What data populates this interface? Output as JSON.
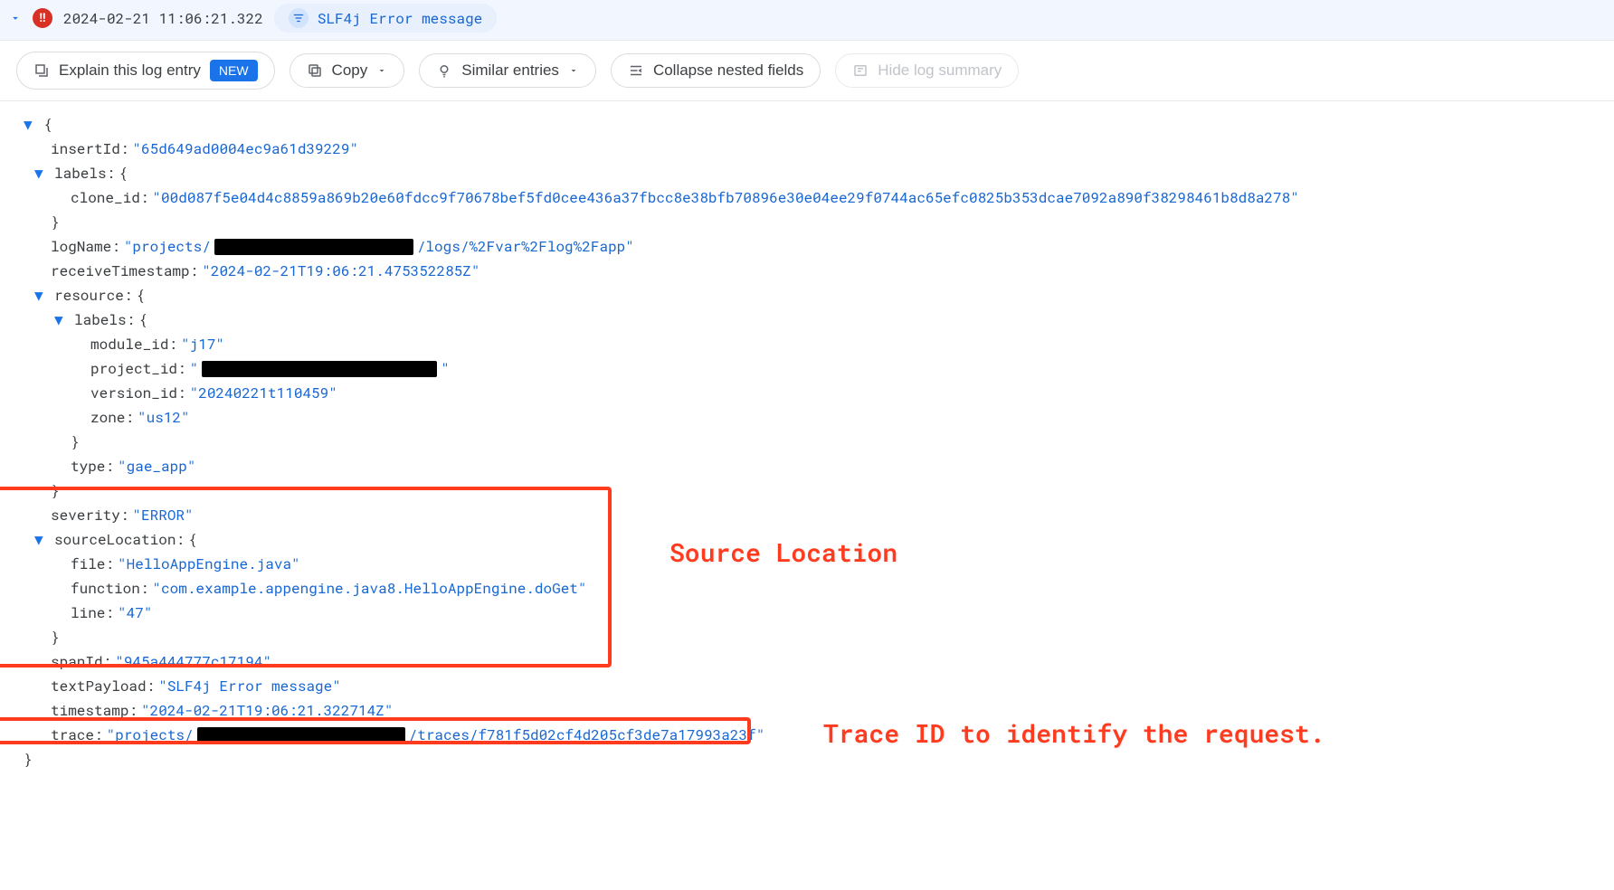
{
  "header": {
    "severity_symbol": "!!",
    "timestamp": "2024-02-21 11:06:21.322",
    "message": "SLF4j Error message"
  },
  "toolbar": {
    "explain": "Explain this log entry",
    "new_badge": "NEW",
    "copy": "Copy",
    "similar": "Similar entries",
    "collapse": "Collapse nested fields",
    "hide_summary": "Hide log summary"
  },
  "log": {
    "insertId_key": "insertId:",
    "insertId_val": "\"65d649ad0004ec9a61d39229\"",
    "labels_key": "labels:",
    "clone_id_key": "clone_id:",
    "clone_id_val": "\"00d087f5e04d4c8859a869b20e60fdcc9f70678bef5fd0cee436a37fbcc8e38bfb70896e30e04ee29f0744ac65efc0825b353dcae7092a890f38298461b8d8a278\"",
    "logName_key": "logName:",
    "logName_pre": "\"projects/",
    "logName_post": "/logs/%2Fvar%2Flog%2Fapp\"",
    "receiveTimestamp_key": "receiveTimestamp:",
    "receiveTimestamp_val": "\"2024-02-21T19:06:21.475352285Z\"",
    "resource_key": "resource:",
    "res_labels_key": "labels:",
    "module_id_key": "module_id:",
    "module_id_val": "\"j17\"",
    "project_id_key": "project_id:",
    "project_id_pre": "\"",
    "project_id_post": "\"",
    "version_id_key": "version_id:",
    "version_id_val": "\"20240221t110459\"",
    "zone_key": "zone:",
    "zone_val": "\"us12\"",
    "type_key": "type:",
    "type_val": "\"gae_app\"",
    "severity_key": "severity:",
    "severity_val": "\"ERROR\"",
    "sourceLocation_key": "sourceLocation:",
    "file_key": "file:",
    "file_val": "\"HelloAppEngine.java\"",
    "function_key": "function:",
    "function_val": "\"com.example.appengine.java8.HelloAppEngine.doGet\"",
    "line_key": "line:",
    "line_val": "\"47\"",
    "spanId_key": "spanId:",
    "spanId_val": "\"945a444777c17194\"",
    "textPayload_key": "textPayload:",
    "textPayload_val": "\"SLF4j Error message\"",
    "timestamp_key": "timestamp:",
    "timestamp_val": "\"2024-02-21T19:06:21.322714Z\"",
    "trace_key": "trace:",
    "trace_pre": "\"projects/",
    "trace_post": "/traces/f781f5d02cf4d205cf3de7a17993a23f\""
  },
  "annotations": {
    "source_location": "Source Location",
    "trace_id": "Trace ID to identify the request."
  }
}
